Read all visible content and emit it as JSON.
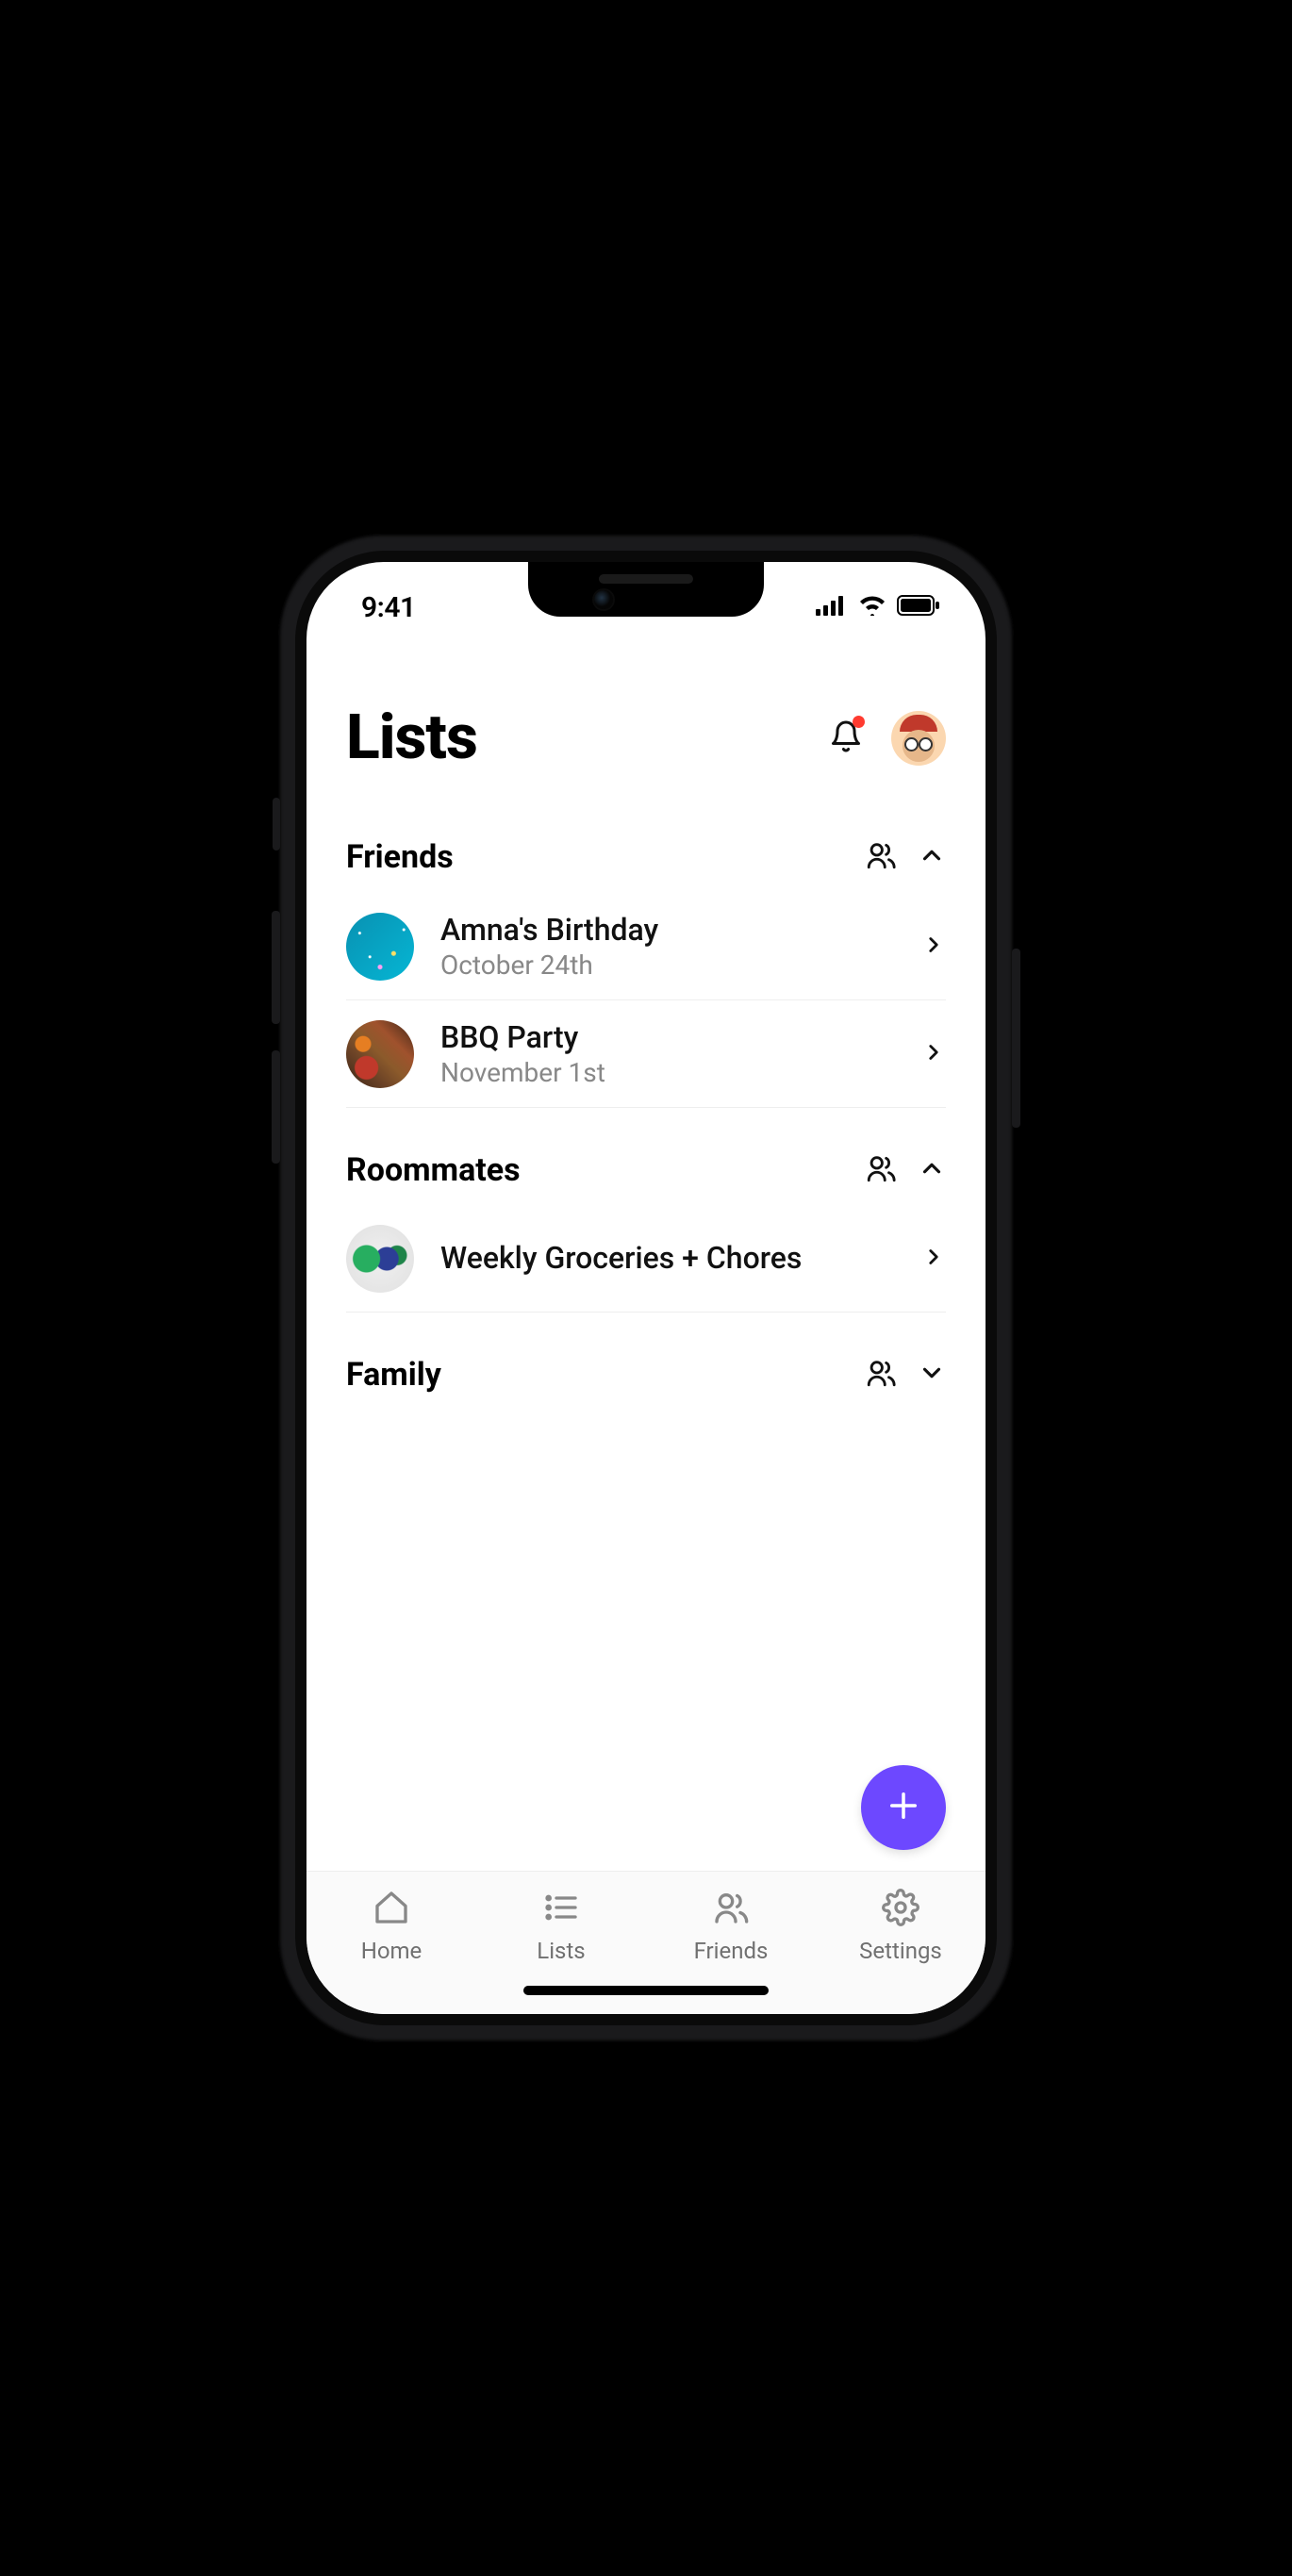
{
  "status": {
    "time": "9:41"
  },
  "header": {
    "title": "Lists",
    "notifications_has_badge": true
  },
  "sections": [
    {
      "title": "Friends",
      "expanded": true,
      "items": [
        {
          "title": "Amna's Birthday",
          "subtitle": "October 24th",
          "avatar": "confetti"
        },
        {
          "title": "BBQ Party",
          "subtitle": "November 1st",
          "avatar": "bbq"
        }
      ]
    },
    {
      "title": "Roommates",
      "expanded": true,
      "items": [
        {
          "title": "Weekly Groceries + Chores",
          "subtitle": "",
          "avatar": "groceries"
        }
      ]
    },
    {
      "title": "Family",
      "expanded": false,
      "items": []
    }
  ],
  "fab": {
    "accent_color": "#6d48ff",
    "icon": "plus"
  },
  "tabbar": {
    "items": [
      {
        "label": "Home",
        "icon": "home"
      },
      {
        "label": "Lists",
        "icon": "list"
      },
      {
        "label": "Friends",
        "icon": "friends"
      },
      {
        "label": "Settings",
        "icon": "settings"
      }
    ]
  }
}
